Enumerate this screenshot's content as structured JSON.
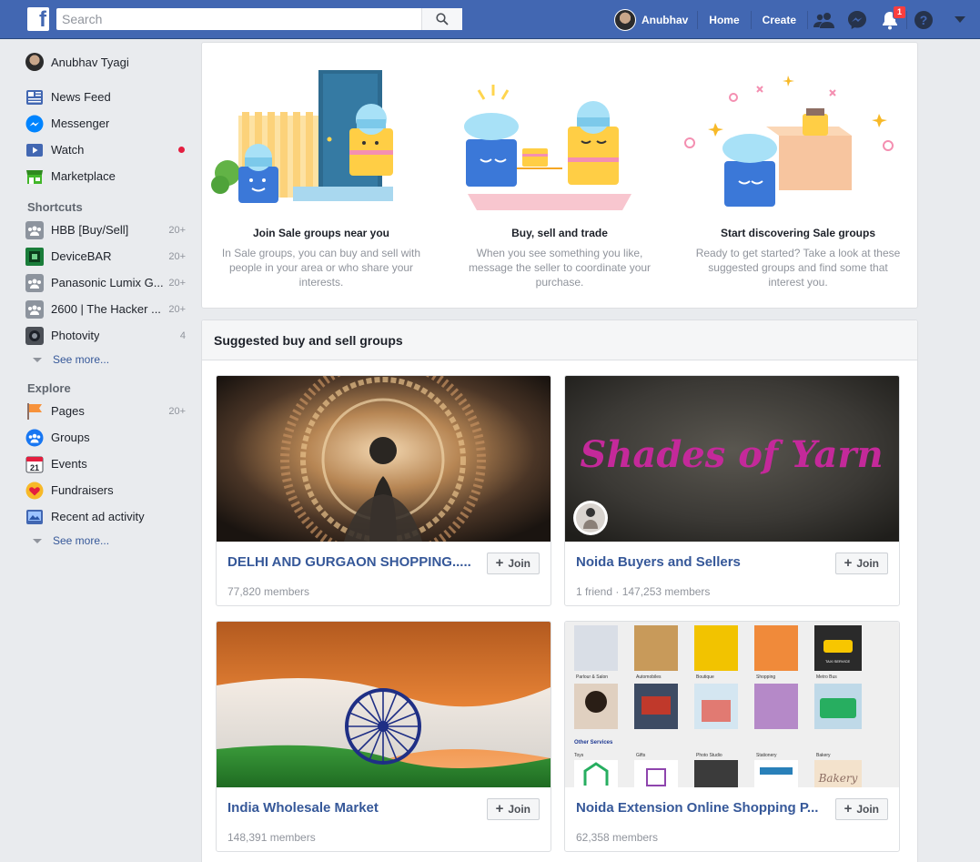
{
  "topbar": {
    "search_placeholder": "Search",
    "user_name": "Anubhav",
    "home_label": "Home",
    "create_label": "Create",
    "notification_count": "1",
    "colors": {
      "bar": "#4267b2",
      "badge": "#fa3e3e"
    }
  },
  "sidebar": {
    "user_full_name": "Anubhav Tyagi",
    "main_items": [
      {
        "label": "News Feed",
        "icon": "news-feed-icon"
      },
      {
        "label": "Messenger",
        "icon": "messenger-icon"
      },
      {
        "label": "Watch",
        "icon": "watch-icon"
      },
      {
        "label": "Marketplace",
        "icon": "marketplace-icon"
      }
    ],
    "shortcuts_heading": "Shortcuts",
    "shortcuts": [
      {
        "label": "HBB [Buy/Sell]",
        "count": "20+"
      },
      {
        "label": "DeviceBAR",
        "count": "20+"
      },
      {
        "label": "Panasonic Lumix G...",
        "count": "20+"
      },
      {
        "label": "2600 | The Hacker ...",
        "count": "20+"
      },
      {
        "label": "Photovity",
        "count": "4"
      }
    ],
    "see_more_1": "See more...",
    "explore_heading": "Explore",
    "explore": [
      {
        "label": "Pages",
        "count": "20+",
        "icon": "pages-flag-icon"
      },
      {
        "label": "Groups",
        "icon": "groups-icon"
      },
      {
        "label": "Events",
        "icon": "calendar-icon",
        "day": "21"
      },
      {
        "label": "Fundraisers",
        "icon": "heart-icon"
      },
      {
        "label": "Recent ad activity",
        "icon": "ad-activity-icon"
      }
    ],
    "see_more_2": "See more..."
  },
  "intro": {
    "columns": [
      {
        "title": "Join Sale groups near you",
        "text": "In Sale groups, you can buy and sell with people in your area or who share your interests."
      },
      {
        "title": "Buy, sell and trade",
        "text": "When you see something you like, message the seller to coordinate your purchase."
      },
      {
        "title": "Start discovering Sale groups",
        "text": "Ready to get started? Take a look at these suggested groups and find some that interest you."
      }
    ]
  },
  "groups": {
    "heading": "Suggested buy and sell groups",
    "join_label": "Join",
    "items": [
      {
        "name": "DELHI AND GURGAON SHOPPING.....",
        "meta": "77,820 members"
      },
      {
        "name": "Noida Buyers and Sellers",
        "meta": "1 friend · 147,253 members",
        "cover_text": "Shades of Yarn"
      },
      {
        "name": "India Wholesale Market",
        "meta": "148,391 members"
      },
      {
        "name": "Noida Extension Online Shopping P...",
        "meta": "62,358 members",
        "cover_labels": [
          "Parlour & Salon",
          "Automobiles",
          "Boutique",
          "Shopping",
          "Metro Bus",
          "Other Services",
          "Toys",
          "Gifts",
          "Photo Studio",
          "Stationery",
          "Bakery",
          "TAXI SERVICE",
          "Bakery"
        ]
      }
    ]
  }
}
